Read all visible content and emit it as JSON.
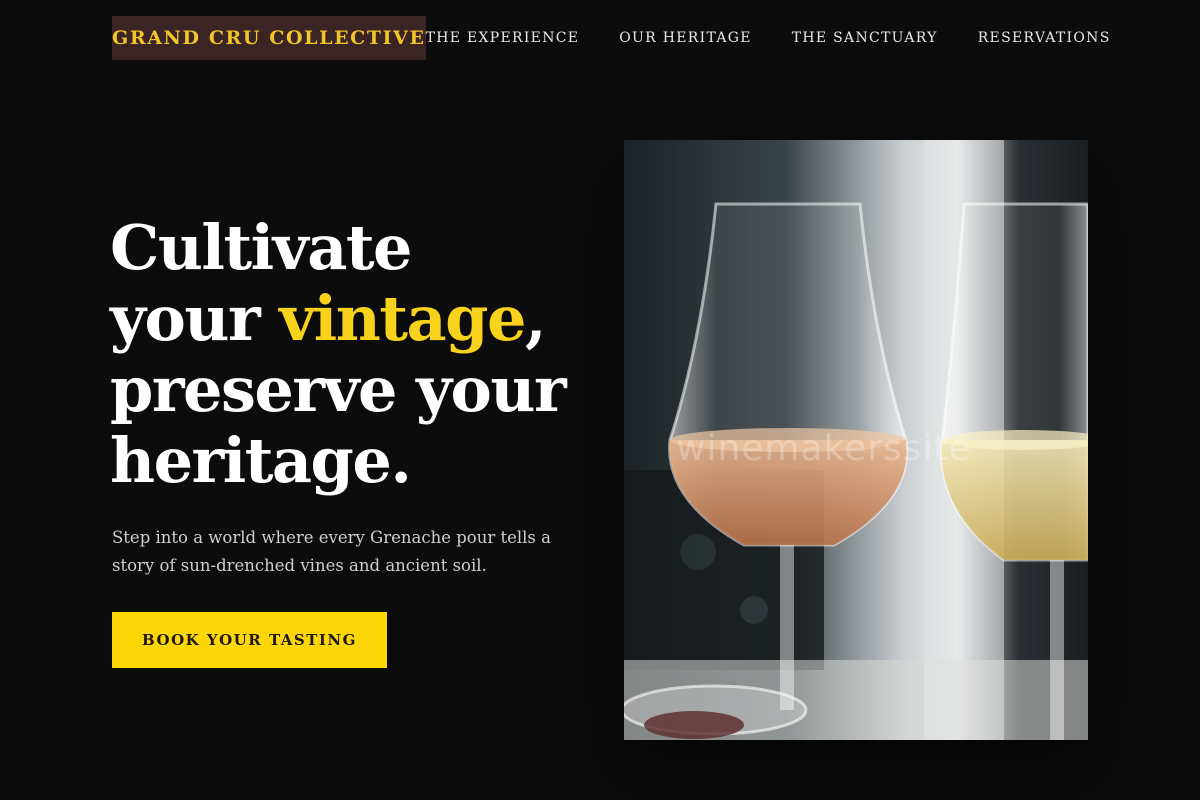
{
  "brand": {
    "name": "GRAND CRU COLLECTIVE"
  },
  "nav": {
    "items": [
      {
        "label": "THE EXPERIENCE"
      },
      {
        "label": "OUR HERITAGE"
      },
      {
        "label": "THE SANCTUARY"
      },
      {
        "label": "RESERVATIONS"
      }
    ]
  },
  "hero": {
    "title_line1": "Cultivate",
    "title_your": "your ",
    "title_accent": "vintage",
    "title_comma": ",",
    "title_line3": "preserve your",
    "title_line4": "heritage.",
    "subtitle": "Step into a world where every Grenache pour tells a story of sun-drenched vines and ancient soil.",
    "cta_label": "BOOK YOUR TASTING"
  },
  "image": {
    "watermark": "winemakerssite"
  },
  "colors": {
    "background": "#0c0c0c",
    "accent": "#f9d21c",
    "cta": "#fdd608",
    "logo_bg": "#3a2424",
    "logo_text": "#f2c52a"
  }
}
